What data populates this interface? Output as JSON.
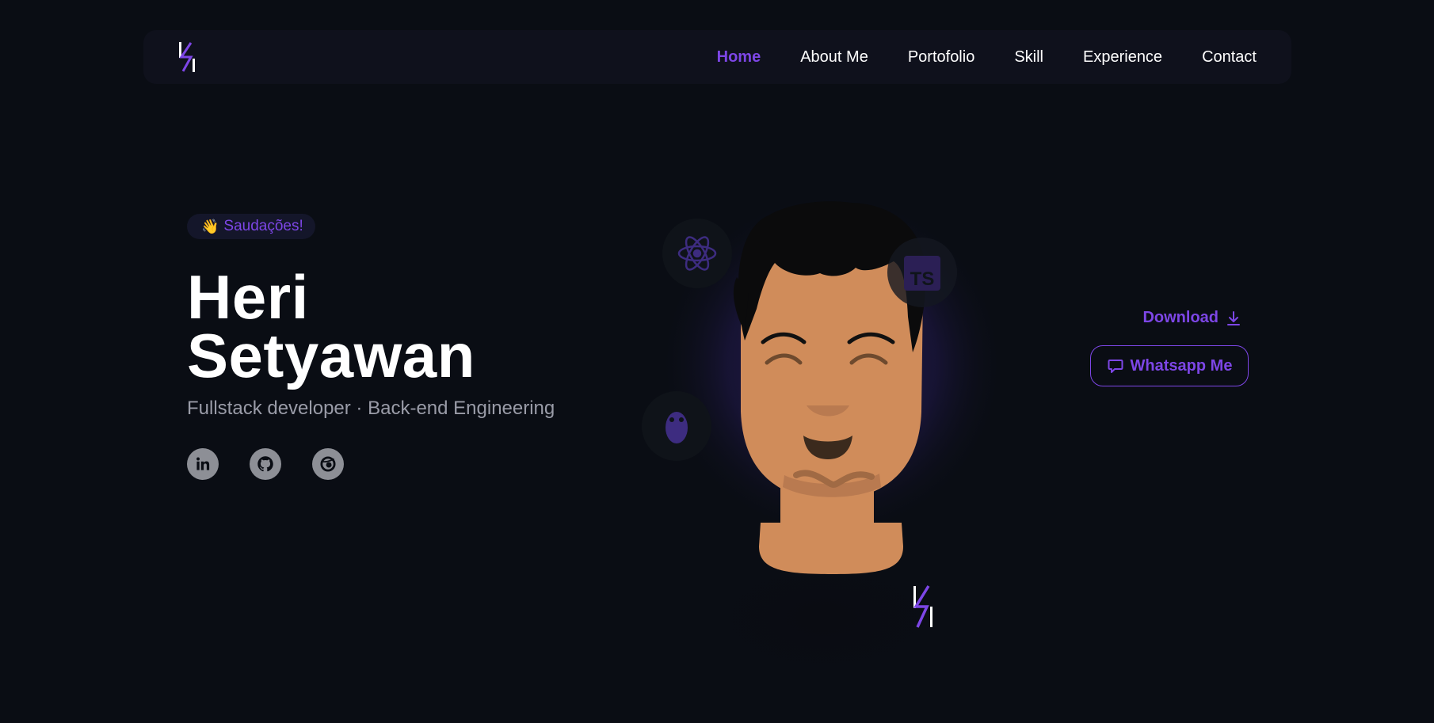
{
  "nav": {
    "logo_name": "hs-bolt-logo",
    "links": [
      {
        "label": "Home",
        "active": true
      },
      {
        "label": "About Me"
      },
      {
        "label": "Portofolio"
      },
      {
        "label": "Skill"
      },
      {
        "label": "Experience"
      },
      {
        "label": "Contact"
      }
    ]
  },
  "hero": {
    "badge": {
      "emoji": "👋",
      "text": "Saudações!"
    },
    "name_line1": "Heri",
    "name_line2": "Setyawan",
    "subtitle": "Fullstack developer · Back-end Engineering",
    "socials": [
      {
        "icon": "linkedin-icon"
      },
      {
        "icon": "github-icon"
      },
      {
        "icon": "dribbble-icon"
      }
    ]
  },
  "actions": {
    "download_label": "Download",
    "whatsapp_label": "Whatsapp Me"
  },
  "avatar": {
    "badges": [
      "react-icon",
      "typescript-icon",
      "golang-gopher-icon"
    ],
    "ts_text": "TS"
  },
  "colors": {
    "background": "#0a0d14",
    "navbar": "#0f111c",
    "accent": "#7d46e6",
    "muted_text": "#9a9ca8",
    "skin": "#d08c5a"
  }
}
